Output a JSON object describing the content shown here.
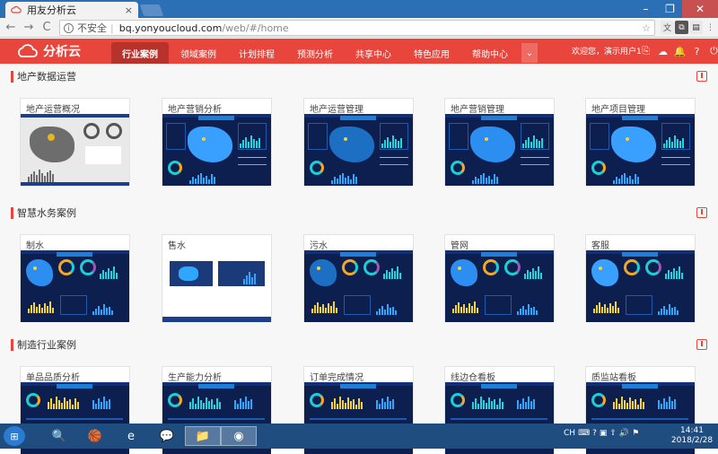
{
  "browser": {
    "tab_title": "用友分析云",
    "tab_close": "×",
    "security_label": "不安全",
    "url_host": "bq.yonyoucloud.com",
    "url_path": "/web/#/home",
    "back": "←",
    "forward": "→",
    "reload": "C",
    "star": "☆",
    "window_min": "–",
    "window_max": "❐",
    "window_close": "✕"
  },
  "app": {
    "logo_text": "分析云",
    "nav_tabs": [
      {
        "label": "行业案例",
        "active": true
      },
      {
        "label": "领域案例"
      },
      {
        "label": "计划排程"
      },
      {
        "label": "预测分析"
      },
      {
        "label": "共享中心"
      },
      {
        "label": "特色应用"
      },
      {
        "label": "帮助中心"
      }
    ],
    "nav_more": "⌄",
    "welcome": "欢迎您，演示用户1",
    "header_icons": [
      "link-icon",
      "cloud-icon",
      "bell-icon",
      "help-icon",
      "power-icon"
    ],
    "header_icon_glyphs": [
      "⎘",
      "☁",
      "🔔",
      "?",
      "⏻"
    ]
  },
  "sections": [
    {
      "title": "地产数据运营",
      "cards": [
        "地产运营概况",
        "地产营销分析",
        "地产运营管理",
        "地产营销管理",
        "地产项目管理"
      ]
    },
    {
      "title": "智慧水务案例",
      "cards": [
        "制水",
        "售水",
        "污水",
        "管网",
        "客服"
      ]
    },
    {
      "title": "制造行业案例",
      "cards": [
        "单品品质分析",
        "生产能力分析",
        "订单完成情况",
        "线边仓看板",
        "质监站看板"
      ]
    }
  ],
  "taskbar": {
    "start_glyph": "⊞",
    "apps": [
      "search-icon",
      "photos-icon",
      "ie-icon",
      "wechat-icon",
      "folder-icon",
      "chrome-icon"
    ],
    "app_glyphs": [
      "🔍",
      "🏀",
      "e",
      "💬",
      "📁",
      "◉"
    ],
    "tray_lang": "CH",
    "time": "14:41",
    "date": "2018/2/28"
  },
  "colors": {
    "brand_red": "#e8453c",
    "active_tab": "#b8322c",
    "dashboard_navy": "#0c1f4e",
    "taskbar": "#1f4d80"
  }
}
